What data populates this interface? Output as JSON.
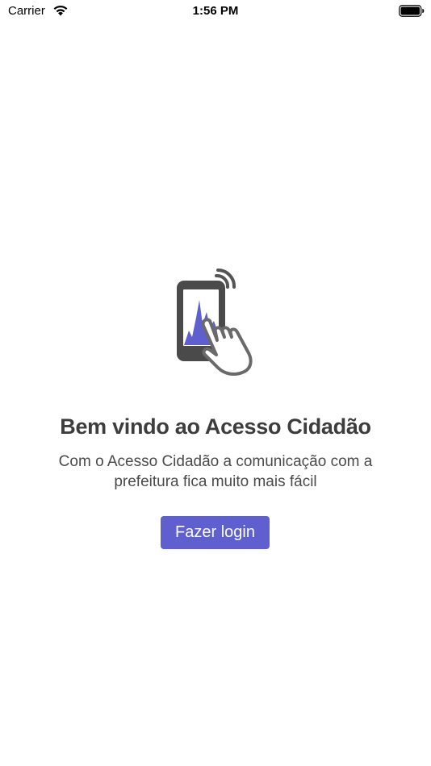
{
  "status_bar": {
    "carrier": "Carrier",
    "time": "1:56 PM",
    "icons": [
      "wifi-icon",
      "battery-icon"
    ]
  },
  "welcome": {
    "icon": "phone-touch-icon",
    "title": "Bem vindo ao Acesso Cidadão",
    "subtitle": "Com o Acesso Cidadão a comunicação com a prefeitura fica muito mais fácil",
    "login_label": "Fazer login"
  },
  "colors": {
    "accent": "#5f5fcf",
    "text": "#3d3d3d",
    "background": "#ffffff"
  }
}
